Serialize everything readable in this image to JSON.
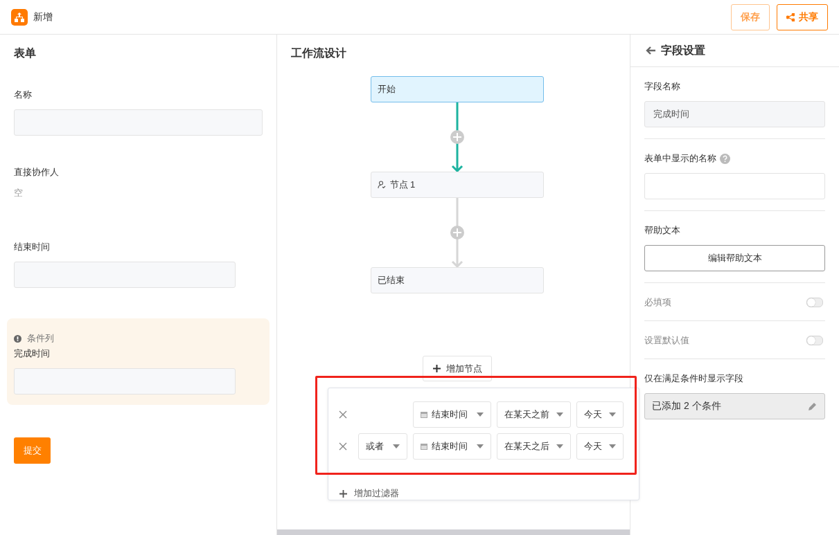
{
  "header": {
    "title": "新增",
    "buttons": [
      {
        "label": "保存",
        "kind": "save"
      },
      {
        "label": "共享",
        "kind": "share"
      }
    ]
  },
  "form": {
    "title": "表单",
    "fields": [
      {
        "label": "名称",
        "kind": "wide-input"
      },
      {
        "label": "直接协作人",
        "kind": "text",
        "value": "空"
      },
      {
        "label": "结束时间",
        "kind": "input"
      }
    ],
    "condition_card": {
      "heading": "条件列",
      "label": "完成时间"
    },
    "submit": "提交"
  },
  "workflow": {
    "title": "工作流设计",
    "nodes": [
      {
        "label": "开始",
        "kind": "start"
      },
      {
        "label": "节点 1",
        "kind": "user"
      },
      {
        "label": "已结束",
        "kind": "end"
      }
    ],
    "connectors": [
      {
        "active": true
      },
      {
        "active": false
      }
    ],
    "add_node": "增加节点"
  },
  "filter_popup": {
    "rows": [
      {
        "field": "结束时间",
        "operator": "在某天之前",
        "value": "今天"
      },
      {
        "conjunction": "或者",
        "field": "结束时间",
        "operator": "在某天之后",
        "value": "今天"
      }
    ],
    "add_filter": "增加过滤器"
  },
  "field_settings": {
    "title": "字段设置",
    "name_label": "字段名称",
    "name_value": "完成时间",
    "display_label": "表单中显示的名称",
    "help_label": "帮助文本",
    "help_button": "编辑帮助文本",
    "toggles": [
      {
        "label": "必填项",
        "on": false
      },
      {
        "label": "设置默认值",
        "on": false
      }
    ],
    "condition_label": "仅在满足条件时显示字段",
    "condition_value": "已添加 2 个条件"
  }
}
